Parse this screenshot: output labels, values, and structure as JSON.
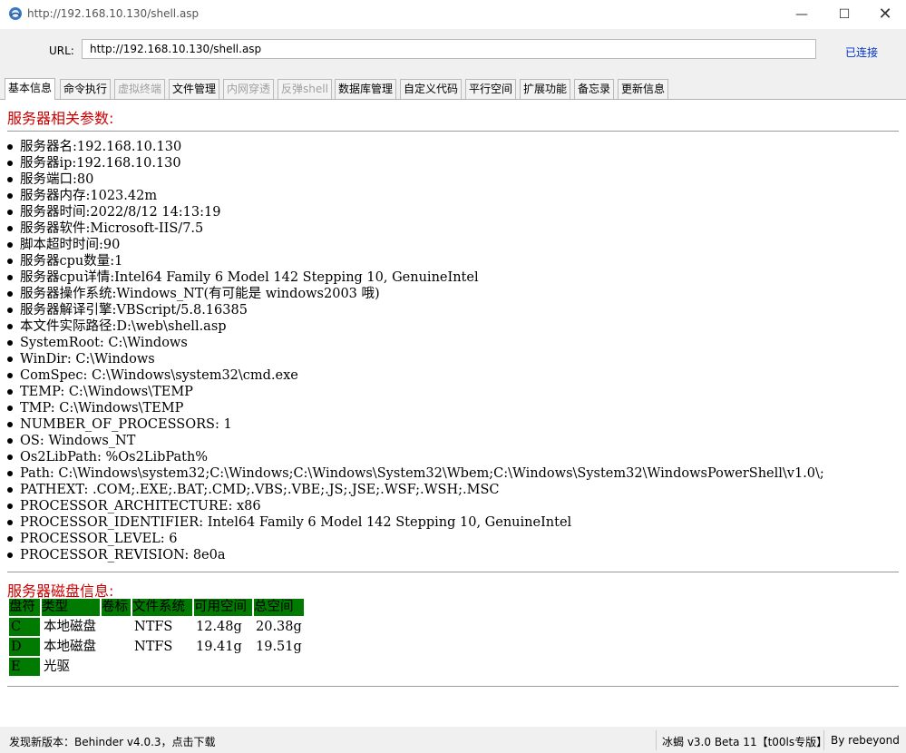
{
  "window": {
    "title": "http://192.168.10.130/shell.asp",
    "min": "—",
    "max": "☐",
    "close": "✕"
  },
  "urlbar": {
    "label": "URL:",
    "value": "http://192.168.10.130/shell.asp",
    "status": "已连接"
  },
  "tabs": [
    {
      "label": "基本信息",
      "state": "active"
    },
    {
      "label": "命令执行",
      "state": "normal"
    },
    {
      "label": "虚拟终端",
      "state": "disabled"
    },
    {
      "label": "文件管理",
      "state": "normal"
    },
    {
      "label": "内网穿透",
      "state": "disabled"
    },
    {
      "label": "反弹shell",
      "state": "disabled"
    },
    {
      "label": "数据库管理",
      "state": "normal"
    },
    {
      "label": "自定义代码",
      "state": "normal"
    },
    {
      "label": "平行空间",
      "state": "normal"
    },
    {
      "label": "扩展功能",
      "state": "normal"
    },
    {
      "label": "备忘录",
      "state": "normal"
    },
    {
      "label": "更新信息",
      "state": "normal"
    }
  ],
  "server": {
    "title": "服务器相关参数:",
    "params": [
      "服务器名:192.168.10.130",
      "服务器ip:192.168.10.130",
      "服务端口:80",
      "服务器内存:1023.42m",
      "服务器时间:2022/8/12 14:13:19",
      "服务器软件:Microsoft-IIS/7.5",
      "脚本超时时间:90",
      "服务器cpu数量:1",
      "服务器cpu详情:Intel64 Family 6 Model 142 Stepping 10, GenuineIntel",
      "服务器操作系统:Windows_NT(有可能是 windows2003 哦)",
      "服务器解译引擎:VBScript/5.8.16385",
      "本文件实际路径:D:\\web\\shell.asp",
      "SystemRoot: C:\\Windows",
      "WinDir: C:\\Windows",
      "ComSpec: C:\\Windows\\system32\\cmd.exe",
      "TEMP: C:\\Windows\\TEMP",
      "TMP: C:\\Windows\\TEMP",
      "NUMBER_OF_PROCESSORS: 1",
      "OS: Windows_NT",
      "Os2LibPath: %Os2LibPath%",
      "Path: C:\\Windows\\system32;C:\\Windows;C:\\Windows\\System32\\Wbem;C:\\Windows\\System32\\WindowsPowerShell\\v1.0\\;",
      "PATHEXT: .COM;.EXE;.BAT;.CMD;.VBS;.VBE;.JS;.JSE;.WSF;.WSH;.MSC",
      "PROCESSOR_ARCHITECTURE: x86",
      "PROCESSOR_IDENTIFIER: Intel64 Family 6 Model 142 Stepping 10, GenuineIntel",
      "PROCESSOR_LEVEL: 6",
      "PROCESSOR_REVISION: 8e0a"
    ]
  },
  "disks": {
    "title": "服务器磁盘信息:",
    "headers": [
      "盘符",
      "类型",
      "卷标",
      "文件系统",
      "可用空间",
      "总空间"
    ],
    "rows": [
      [
        "C",
        "本地磁盘",
        "",
        "NTFS",
        "12.48g",
        "20.38g"
      ],
      [
        "D",
        "本地磁盘",
        "",
        "NTFS",
        "19.41g",
        "19.51g"
      ],
      [
        "E",
        "光驱",
        "",
        "",
        "",
        ""
      ]
    ]
  },
  "status": {
    "update": "发现新版本：Behinder v4.0.3，点击下载",
    "version": "冰蝎 v3.0 Beta 11【t00ls专版】",
    "author": "By rebeyond"
  },
  "colors": {
    "accent_red": "#cc0000",
    "header_green": "#007a00",
    "link_blue": "#0033cc"
  }
}
